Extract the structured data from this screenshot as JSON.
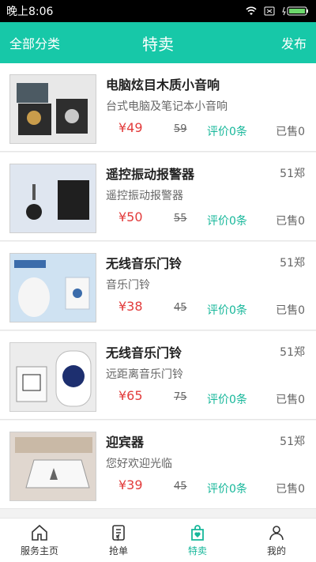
{
  "status": {
    "time": "晚上8:06"
  },
  "topbar": {
    "left": "全部分类",
    "title": "特卖",
    "right": "发布"
  },
  "products": [
    {
      "name": "电脑炫目木质小音响",
      "store": "",
      "desc": "台式电脑及笔记本小音响",
      "price": "¥49",
      "orig": "59",
      "reviews": "评价0条",
      "sold": "已售0"
    },
    {
      "name": "遥控振动报警器",
      "store": "51郑",
      "desc": "遥控振动报警器",
      "price": "¥50",
      "orig": "55",
      "reviews": "评价0条",
      "sold": "已售0"
    },
    {
      "name": "无线音乐门铃",
      "store": "51郑",
      "desc": "音乐门铃",
      "price": "¥38",
      "orig": "45",
      "reviews": "评价0条",
      "sold": "已售0"
    },
    {
      "name": "无线音乐门铃",
      "store": "51郑",
      "desc": "远距离音乐门铃",
      "price": "¥65",
      "orig": "75",
      "reviews": "评价0条",
      "sold": "已售0"
    },
    {
      "name": "迎宾器",
      "store": "51郑",
      "desc": "您好欢迎光临",
      "price": "¥39",
      "orig": "45",
      "reviews": "评价0条",
      "sold": "已售0"
    }
  ],
  "nav": {
    "home": "服务主页",
    "grab": "抢单",
    "sale": "特卖",
    "mine": "我的"
  },
  "colors": {
    "accent": "#17c8a8",
    "price": "#e23b3b",
    "review": "#16b79a"
  }
}
